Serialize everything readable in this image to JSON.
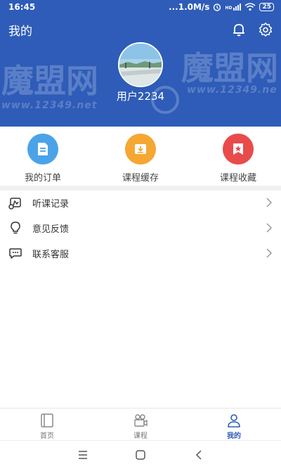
{
  "status_bar": {
    "time": "16:45",
    "network_speed": "...1.0M/s",
    "signal_label": "HD",
    "battery": "25"
  },
  "header": {
    "title": "我的",
    "username": "用户2234",
    "icons": [
      "bell-icon",
      "gear-icon"
    ]
  },
  "watermark": {
    "text_left": "魔盟网",
    "url_left": "www.12349.net",
    "text_right": "魔盟网",
    "url_right": "www.12349.ne"
  },
  "quick_actions": [
    {
      "label": "我的订单",
      "icon": "order-document-icon",
      "color": "#4aa3e8"
    },
    {
      "label": "课程缓存",
      "icon": "download-icon",
      "color": "#f5a733"
    },
    {
      "label": "课程收藏",
      "icon": "star-bookmark-icon",
      "color": "#e94b4b"
    }
  ],
  "menu": [
    {
      "label": "听课记录",
      "icon": "history-icon"
    },
    {
      "label": "意见反馈",
      "icon": "lightbulb-icon"
    },
    {
      "label": "联系客服",
      "icon": "chat-icon"
    }
  ],
  "tabbar": [
    {
      "label": "首页",
      "icon": "book-icon",
      "active": false
    },
    {
      "label": "课程",
      "icon": "video-camera-icon",
      "active": false
    },
    {
      "label": "我的",
      "icon": "user-icon",
      "active": true
    }
  ],
  "colors": {
    "primary": "#2e5cb8",
    "accent_blue": "#4aa3e8",
    "accent_orange": "#f5a733",
    "accent_red": "#e94b4b"
  }
}
